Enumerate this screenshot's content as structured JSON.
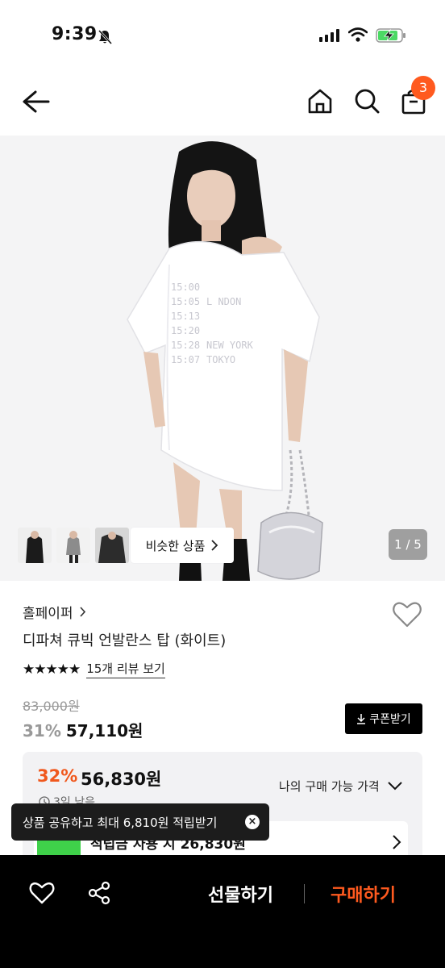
{
  "status_bar": {
    "time": "9:39"
  },
  "header": {
    "cart_count": "3"
  },
  "gallery": {
    "similar_label": "비슷한 상품",
    "counter": "1 / 5",
    "shirt_print": [
      "15:00",
      "15:05",
      "15:13",
      "15:20",
      "15:28",
      "15:07",
      "L NDON",
      "NEW YORK",
      "TOKYO"
    ]
  },
  "product": {
    "brand": "홀페이퍼",
    "name": "디파쳐 큐빅 언발란스 탑 (화이트)",
    "stars": "★★★★★",
    "review_link": "15개 리뷰 보기",
    "original_price": "83,000원",
    "discount": "31%",
    "price": "57,110원",
    "coupon_label": "쿠폰받기"
  },
  "my_price": {
    "discount": "32%",
    "price": "56,830원",
    "label": "나의 구매 가능 가격",
    "timer": "3일 남음",
    "offer_text": "적립금 사용 시 26,830원"
  },
  "toast": {
    "message": "상품 공유하고 최대 6,810원 적립받기"
  },
  "bottom_bar": {
    "gift_label": "선물하기",
    "buy_label": "구매하기"
  },
  "colors": {
    "accent": "#ff5a1f",
    "my_discount": "#f0581d",
    "bottom_bg": "#000000"
  }
}
